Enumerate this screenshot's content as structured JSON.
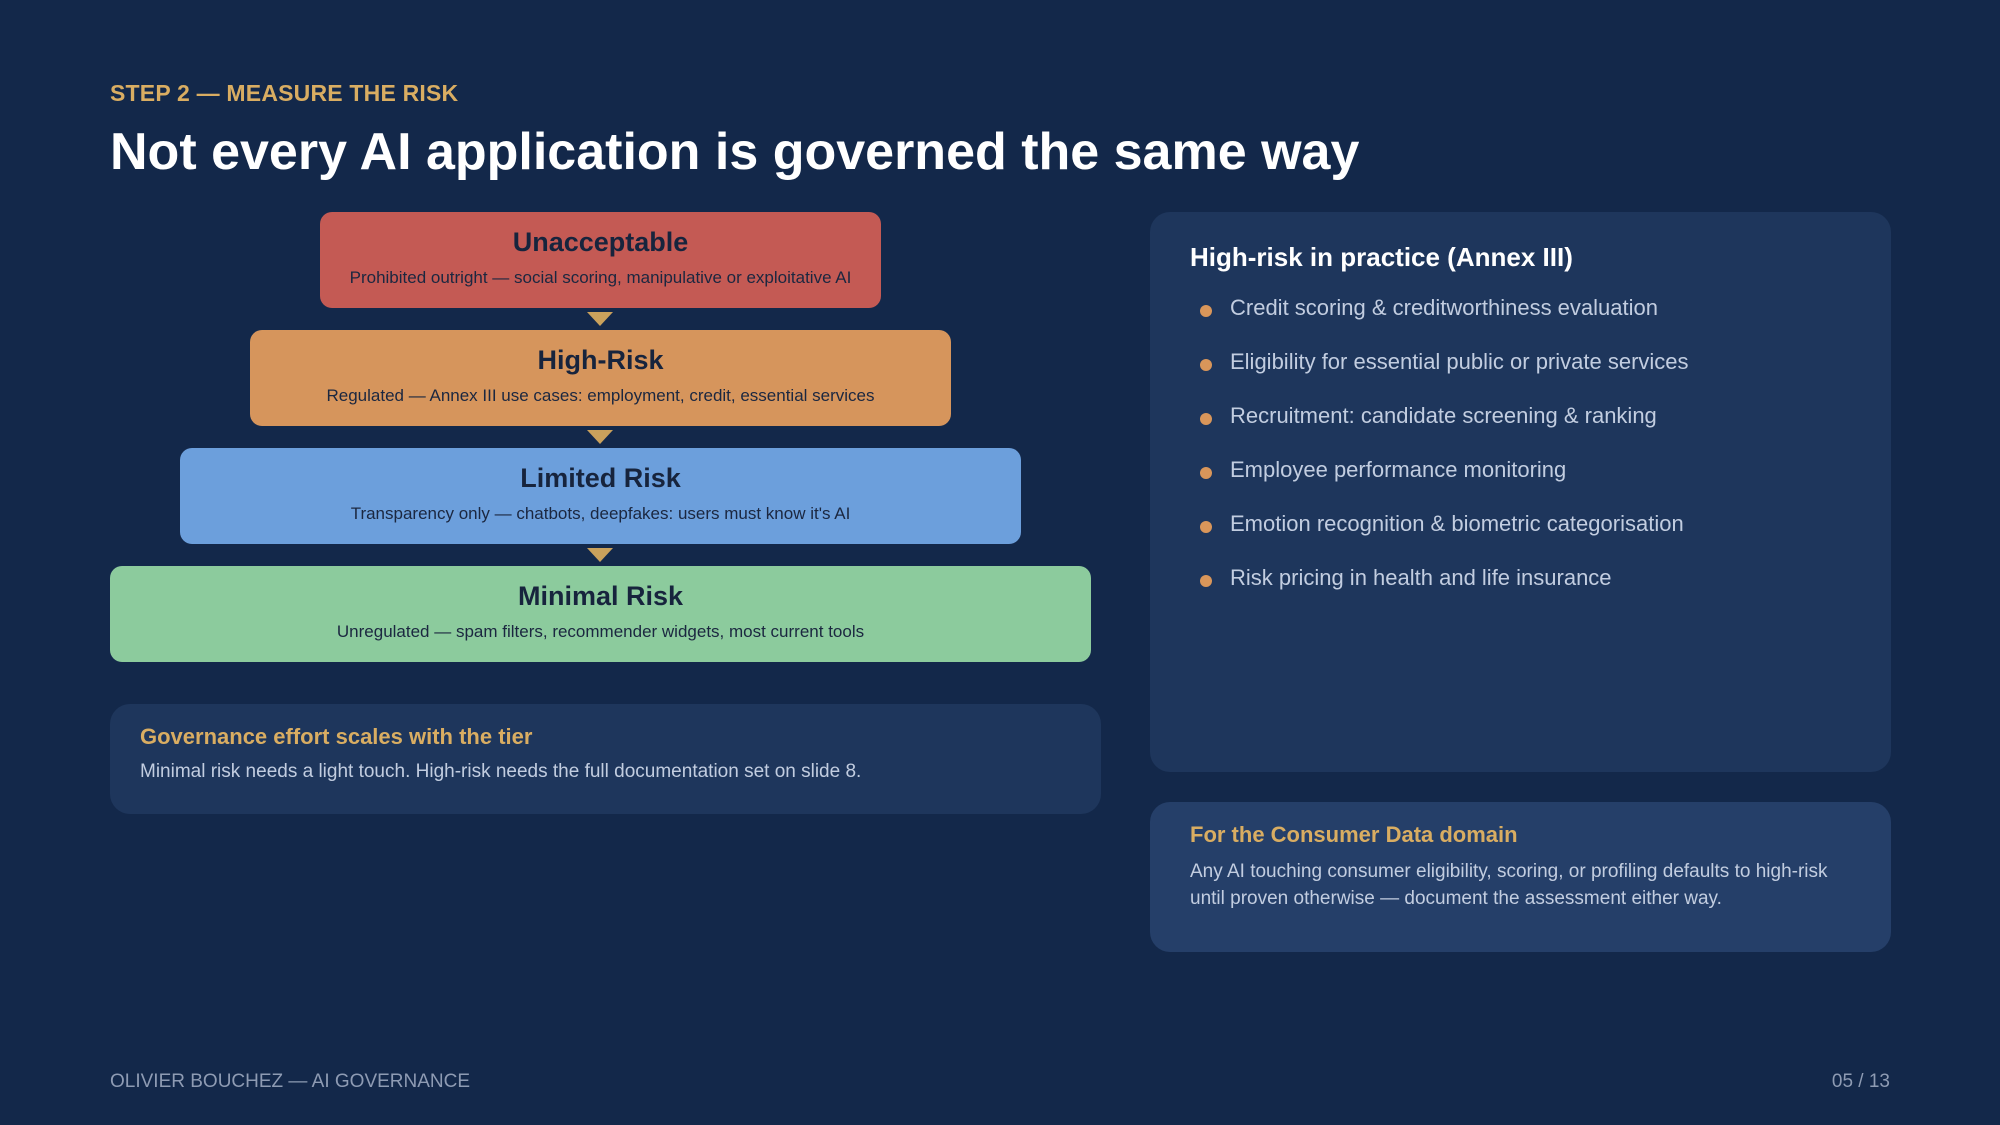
{
  "header": {
    "kicker": "STEP 2 — MEASURE THE RISK",
    "title": "Not every AI application is governed the same way"
  },
  "tiers": [
    {
      "name": "Unacceptable",
      "description": "Prohibited outright — social scoring, manipulative or exploitative AI",
      "color": "#c45a54"
    },
    {
      "name": "High-Risk",
      "description": "Regulated — Annex III use cases: employment, credit, essential services",
      "color": "#d6955c"
    },
    {
      "name": "Limited Risk",
      "description": "Transparency only — chatbots, deepfakes: users must know it's AI",
      "color": "#6c9fdc"
    },
    {
      "name": "Minimal Risk",
      "description": "Unregulated — spam filters, recommender widgets, most current tools",
      "color": "#8ccb9d"
    }
  ],
  "governance_card": {
    "heading": "Governance effort scales with the tier",
    "body": "Minimal risk needs a light touch. High-risk needs the full documentation set on slide 8."
  },
  "practice_card": {
    "heading": "High-risk in practice (Annex III)",
    "items": [
      "Credit scoring & creditworthiness evaluation",
      "Eligibility for essential public or private services",
      "Recruitment: candidate screening & ranking",
      "Employee performance monitoring",
      "Emotion recognition & biometric categorisation",
      "Risk pricing in health and life insurance"
    ]
  },
  "consumer_card": {
    "heading": "For the Consumer Data domain",
    "body": "Any AI touching consumer eligibility, scoring, or profiling defaults to high-risk until proven otherwise — document the assessment either way."
  },
  "footer": {
    "author": "OLIVIER BOUCHEZ  —  AI GOVERNANCE",
    "page": "05 / 13"
  },
  "colors": {
    "background": "#13284a",
    "card": "#1e365c",
    "accent": "#d9ad62",
    "bullet": "#d9965a"
  }
}
